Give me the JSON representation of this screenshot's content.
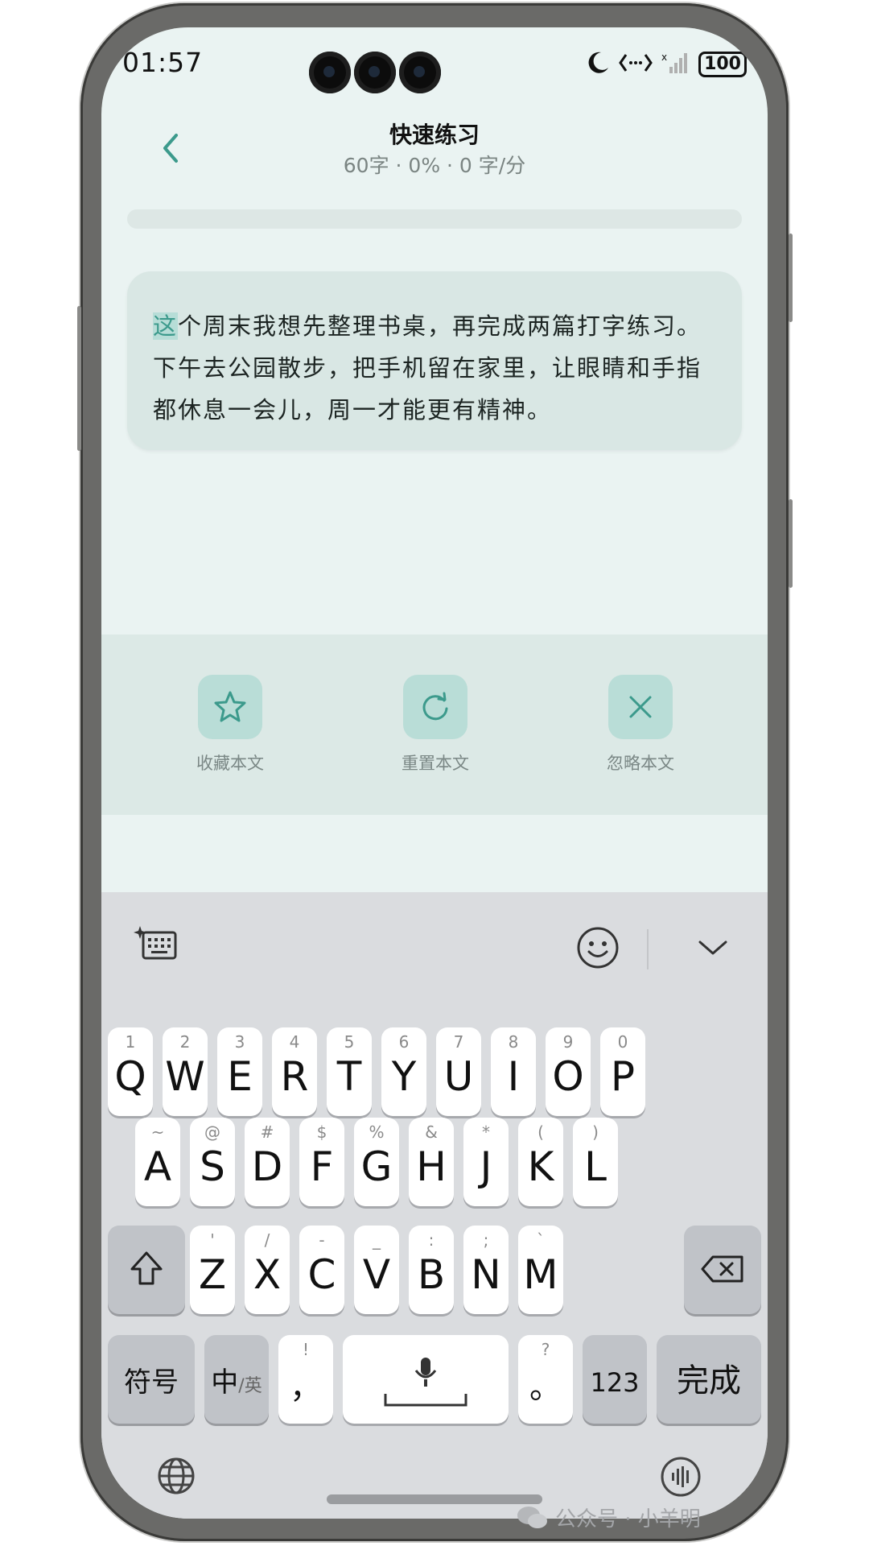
{
  "status_bar": {
    "time": "01:57",
    "battery": "100"
  },
  "header": {
    "title": "快速练习",
    "subtitle": "60字 · 0% · 0 字/分"
  },
  "progress": {
    "percent": 0
  },
  "practice_text": {
    "current_char": "这",
    "remaining": "个周末我想先整理书桌，再完成两篇打字练习。下午去公园散步，把手机留在家里，让眼睛和手指都休息一会儿，周一才能更有精神。"
  },
  "actions": [
    {
      "label": "收藏本文",
      "icon": "star-icon"
    },
    {
      "label": "重置本文",
      "icon": "refresh-icon"
    },
    {
      "label": "忽略本文",
      "icon": "close-icon"
    }
  ],
  "keyboard": {
    "row1": [
      {
        "main": "Q",
        "hint": "1"
      },
      {
        "main": "W",
        "hint": "2"
      },
      {
        "main": "E",
        "hint": "3"
      },
      {
        "main": "R",
        "hint": "4"
      },
      {
        "main": "T",
        "hint": "5"
      },
      {
        "main": "Y",
        "hint": "6"
      },
      {
        "main": "U",
        "hint": "7"
      },
      {
        "main": "I",
        "hint": "8"
      },
      {
        "main": "O",
        "hint": "9"
      },
      {
        "main": "P",
        "hint": "0"
      }
    ],
    "row2": [
      {
        "main": "A",
        "hint": "~"
      },
      {
        "main": "S",
        "hint": "@"
      },
      {
        "main": "D",
        "hint": "#"
      },
      {
        "main": "F",
        "hint": "$"
      },
      {
        "main": "G",
        "hint": "%"
      },
      {
        "main": "H",
        "hint": "&"
      },
      {
        "main": "J",
        "hint": "*"
      },
      {
        "main": "K",
        "hint": "("
      },
      {
        "main": "L",
        "hint": ")"
      }
    ],
    "row3": [
      {
        "main": "Z",
        "hint": "'"
      },
      {
        "main": "X",
        "hint": "/"
      },
      {
        "main": "C",
        "hint": "-"
      },
      {
        "main": "V",
        "hint": "_"
      },
      {
        "main": "B",
        "hint": ":"
      },
      {
        "main": "N",
        "hint": ";"
      },
      {
        "main": "M",
        "hint": "`"
      }
    ],
    "symbol_key": "符号",
    "lang_main": "中",
    "lang_sub": "/英",
    "comma": {
      "main": "，",
      "hint": "!"
    },
    "period": {
      "main": "。",
      "hint": "?"
    },
    "num_key": "123",
    "done_key": "完成"
  },
  "watermark": {
    "text": "公众号 · 小羊明"
  },
  "colors": {
    "accent": "#3c9a8c",
    "screen_bg": "#eaf3f2",
    "card_bg": "#d9e7e4",
    "keyboard_bg": "#dadcdf"
  }
}
